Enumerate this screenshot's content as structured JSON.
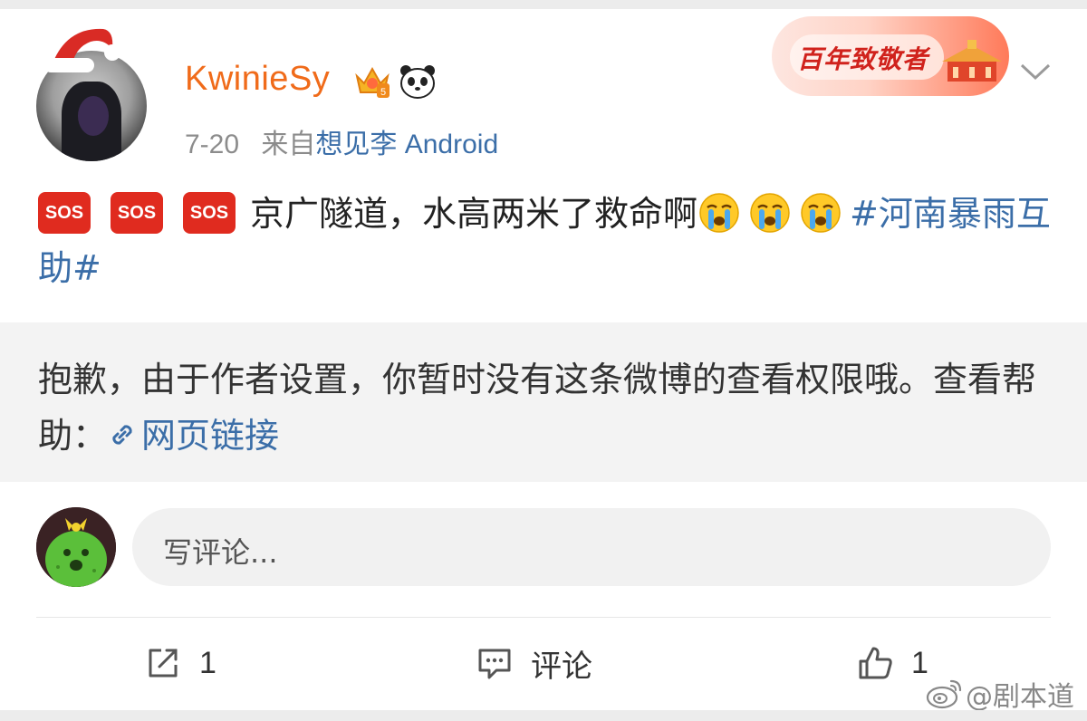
{
  "post": {
    "username": "KwinieSy",
    "date": "7-20",
    "source_prefix": "来自",
    "source": "想见李 Android",
    "sos_label": "SOS",
    "text_main": "京广隧道，水高两米了救命啊",
    "hashtag": "#河南暴雨互助#"
  },
  "banner": {
    "text": "百年致敬者"
  },
  "notice": {
    "text": "抱歉，由于作者设置，你暂时没有这条微博的查看权限哦。查看帮助：",
    "link_label": "网页链接"
  },
  "comment": {
    "placeholder": "写评论..."
  },
  "actions": {
    "repost_count": "1",
    "comment_label": "评论",
    "like_count": "1"
  },
  "watermark": {
    "text": "@剧本道"
  },
  "colors": {
    "username": "#f06b1a",
    "link": "#3b6ea8",
    "sos": "#e02b1f",
    "notice_bg": "#f3f3f3"
  },
  "icons": [
    "santa-hat-icon",
    "crown-icon",
    "panda-icon",
    "chevron-down-icon",
    "sos-icon",
    "crying-face-icon",
    "link-icon",
    "repost-icon",
    "comment-icon",
    "like-icon",
    "weibo-logo-icon"
  ]
}
